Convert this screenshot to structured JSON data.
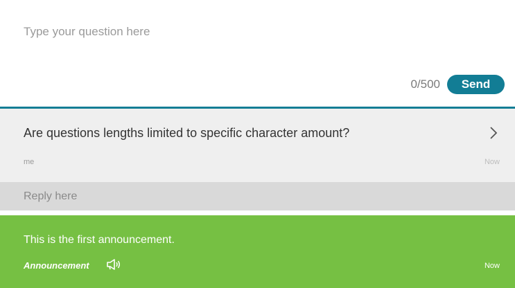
{
  "composer": {
    "placeholder": "Type your question here",
    "char_count": "0/500",
    "send_label": "Send"
  },
  "question": {
    "text": "Are questions lengths limited to specific character amount?",
    "author": "me",
    "time": "Now",
    "chevron_icon": "chevron-right-icon"
  },
  "reply": {
    "placeholder": "Reply here"
  },
  "announcement": {
    "text": "This is the first announcement.",
    "label": "Announcement",
    "icon": "megaphone-icon",
    "time": "Now"
  },
  "colors": {
    "accent": "#127d95",
    "announcement_bg": "#76c043",
    "question_bg": "#efefef",
    "reply_bg": "#d9d9d9"
  }
}
